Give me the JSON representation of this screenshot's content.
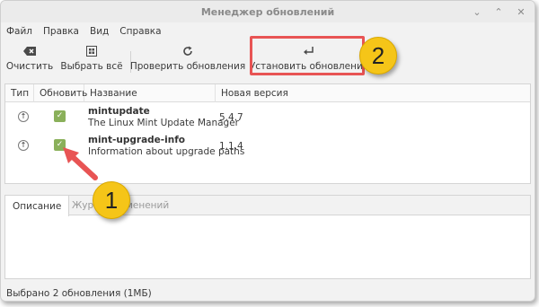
{
  "window": {
    "title": "Менеджер обновлений",
    "controls": {
      "minimize": "⌄",
      "maximize": "⌃",
      "close": "✕"
    }
  },
  "menu": {
    "items": [
      "Файл",
      "Правка",
      "Вид",
      "Справка"
    ]
  },
  "toolbar": {
    "clear_label": "Очистить",
    "clear_icon": "backspace-icon",
    "select_all_label": "Выбрать всё",
    "select_all_icon": "select-all-icon",
    "refresh_label": "Проверить обновления",
    "refresh_icon": "refresh-icon",
    "install_label": "Установить обновления",
    "install_icon": "enter-icon"
  },
  "table": {
    "headers": {
      "type": "Тип",
      "update": "Обновить",
      "name": "Название",
      "new_version": "Новая версия"
    },
    "rows": [
      {
        "type_icon": "upgrade-arrow-icon",
        "checked": true,
        "package": "mintupdate",
        "description": "The Linux Mint Update Manager",
        "version": "5.4.7"
      },
      {
        "type_icon": "upgrade-arrow-icon",
        "checked": true,
        "package": "mint-upgrade-info",
        "description": "Information about upgrade paths",
        "version": "1.1.4"
      }
    ]
  },
  "tabs": {
    "description": "Описание",
    "changelog": "Журнал изменений"
  },
  "status": {
    "text": "Выбрано 2 обновления (1МБ)"
  },
  "annotations": {
    "badge1": "1",
    "badge2": "2"
  },
  "colors": {
    "highlight": "#e85454",
    "badge": "#f5c518",
    "checkbox": "#8ab05a"
  }
}
